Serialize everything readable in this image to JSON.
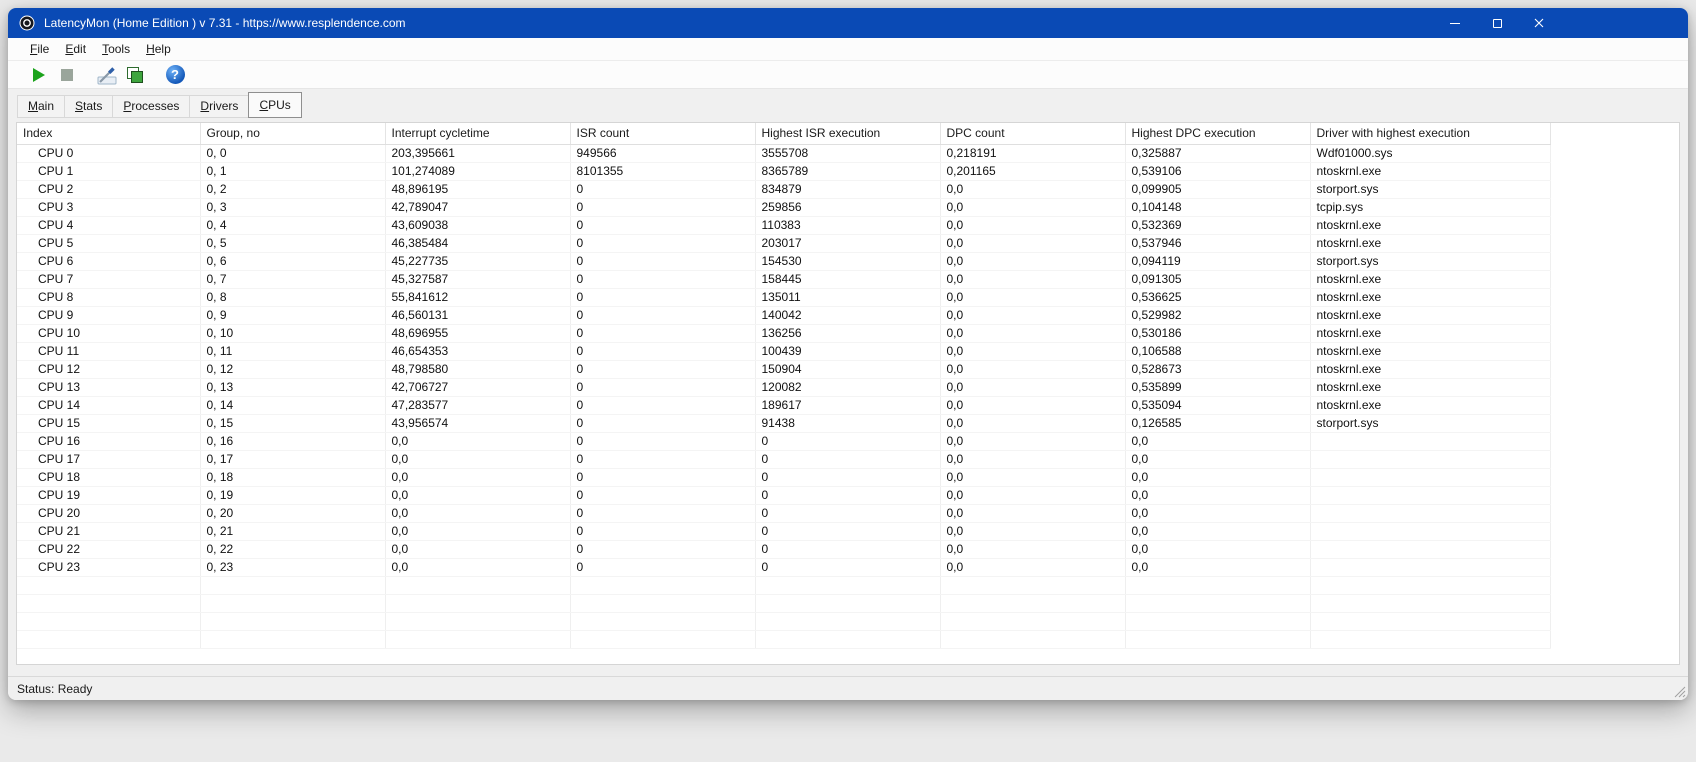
{
  "colors": {
    "titlebar_blue": "#0a4ab5",
    "play_green": "#1ca31c",
    "copy_green": "#3ea53e",
    "help_blue": "#1257b8"
  },
  "window": {
    "title": "LatencyMon  (Home Edition )  v 7.31 - https://www.resplendence.com"
  },
  "menu": {
    "items": [
      "File",
      "Edit",
      "Tools",
      "Help"
    ]
  },
  "toolbar": {
    "buttons": [
      "start-monitor-icon",
      "stop-monitor-icon",
      "tools-icon",
      "copy-icon",
      "help-icon"
    ],
    "help_glyph": "?"
  },
  "tabs": [
    "Main",
    "Stats",
    "Processes",
    "Drivers",
    "CPUs"
  ],
  "active_tab": "CPUs",
  "table": {
    "columns": [
      "Index",
      "Group, no",
      "Interrupt cycletime",
      "ISR count",
      "Highest ISR execution",
      "DPC count",
      "Highest DPC execution",
      "Driver with highest execution"
    ],
    "rows": [
      [
        "CPU 0",
        "0, 0",
        "203,395661",
        "949566",
        "3555708",
        "0,218191",
        "0,325887",
        "Wdf01000.sys"
      ],
      [
        "CPU 1",
        "0, 1",
        "101,274089",
        "8101355",
        "8365789",
        "0,201165",
        "0,539106",
        "ntoskrnl.exe"
      ],
      [
        "CPU 2",
        "0, 2",
        "48,896195",
        "0",
        "834879",
        "0,0",
        "0,099905",
        "storport.sys"
      ],
      [
        "CPU 3",
        "0, 3",
        "42,789047",
        "0",
        "259856",
        "0,0",
        "0,104148",
        "tcpip.sys"
      ],
      [
        "CPU 4",
        "0, 4",
        "43,609038",
        "0",
        "110383",
        "0,0",
        "0,532369",
        "ntoskrnl.exe"
      ],
      [
        "CPU 5",
        "0, 5",
        "46,385484",
        "0",
        "203017",
        "0,0",
        "0,537946",
        "ntoskrnl.exe"
      ],
      [
        "CPU 6",
        "0, 6",
        "45,227735",
        "0",
        "154530",
        "0,0",
        "0,094119",
        "storport.sys"
      ],
      [
        "CPU 7",
        "0, 7",
        "45,327587",
        "0",
        "158445",
        "0,0",
        "0,091305",
        "ntoskrnl.exe"
      ],
      [
        "CPU 8",
        "0, 8",
        "55,841612",
        "0",
        "135011",
        "0,0",
        "0,536625",
        "ntoskrnl.exe"
      ],
      [
        "CPU 9",
        "0, 9",
        "46,560131",
        "0",
        "140042",
        "0,0",
        "0,529982",
        "ntoskrnl.exe"
      ],
      [
        "CPU 10",
        "0, 10",
        "48,696955",
        "0",
        "136256",
        "0,0",
        "0,530186",
        "ntoskrnl.exe"
      ],
      [
        "CPU 11",
        "0, 11",
        "46,654353",
        "0",
        "100439",
        "0,0",
        "0,106588",
        "ntoskrnl.exe"
      ],
      [
        "CPU 12",
        "0, 12",
        "48,798580",
        "0",
        "150904",
        "0,0",
        "0,528673",
        "ntoskrnl.exe"
      ],
      [
        "CPU 13",
        "0, 13",
        "42,706727",
        "0",
        "120082",
        "0,0",
        "0,535899",
        "ntoskrnl.exe"
      ],
      [
        "CPU 14",
        "0, 14",
        "47,283577",
        "0",
        "189617",
        "0,0",
        "0,535094",
        "ntoskrnl.exe"
      ],
      [
        "CPU 15",
        "0, 15",
        "43,956574",
        "0",
        "91438",
        "0,0",
        "0,126585",
        "storport.sys"
      ],
      [
        "CPU 16",
        "0, 16",
        "0,0",
        "0",
        "0",
        "0,0",
        "0,0",
        ""
      ],
      [
        "CPU 17",
        "0, 17",
        "0,0",
        "0",
        "0",
        "0,0",
        "0,0",
        ""
      ],
      [
        "CPU 18",
        "0, 18",
        "0,0",
        "0",
        "0",
        "0,0",
        "0,0",
        ""
      ],
      [
        "CPU 19",
        "0, 19",
        "0,0",
        "0",
        "0",
        "0,0",
        "0,0",
        ""
      ],
      [
        "CPU 20",
        "0, 20",
        "0,0",
        "0",
        "0",
        "0,0",
        "0,0",
        ""
      ],
      [
        "CPU 21",
        "0, 21",
        "0,0",
        "0",
        "0",
        "0,0",
        "0,0",
        ""
      ],
      [
        "CPU 22",
        "0, 22",
        "0,0",
        "0",
        "0",
        "0,0",
        "0,0",
        ""
      ],
      [
        "CPU 23",
        "0, 23",
        "0,0",
        "0",
        "0",
        "0,0",
        "0,0",
        ""
      ]
    ],
    "empty_row_count": 4
  },
  "status_bar": {
    "text": "Status: Ready"
  }
}
